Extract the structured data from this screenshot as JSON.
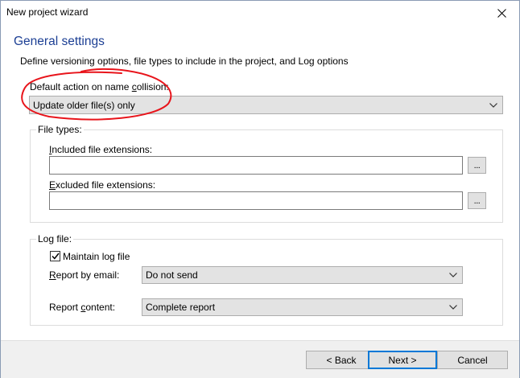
{
  "window": {
    "title": "New project wizard"
  },
  "page": {
    "heading": "General settings",
    "description": "Define versioning options, file types to include in the project, and Log options"
  },
  "collision": {
    "label_before": "Default action on name ",
    "label_mnemonic": "c",
    "label_after": "ollision:",
    "selected": "Update older file(s) only"
  },
  "file_types": {
    "legend": "File types:",
    "included": {
      "label_mnemonic": "I",
      "label_rest": "ncluded file extensions:",
      "value": "",
      "browse": "..."
    },
    "excluded": {
      "label_mnemonic": "E",
      "label_rest": "xcluded file extensions:",
      "value": "",
      "browse": "..."
    }
  },
  "log_file": {
    "legend": "Log file:",
    "maintain": {
      "label": "Maintain log file",
      "checked": true
    },
    "report_email": {
      "label_mnemonic": "R",
      "label_rest": "eport by email:",
      "selected": "Do not send"
    },
    "report_content": {
      "label_before": "Report ",
      "label_mnemonic": "c",
      "label_after": "ontent:",
      "selected": "Complete report"
    }
  },
  "buttons": {
    "back": "< Back",
    "next": "Next >",
    "cancel": "Cancel"
  },
  "colors": {
    "heading": "#1c3f94",
    "annotation": "#e8141b",
    "default_button_border": "#0078d7"
  }
}
